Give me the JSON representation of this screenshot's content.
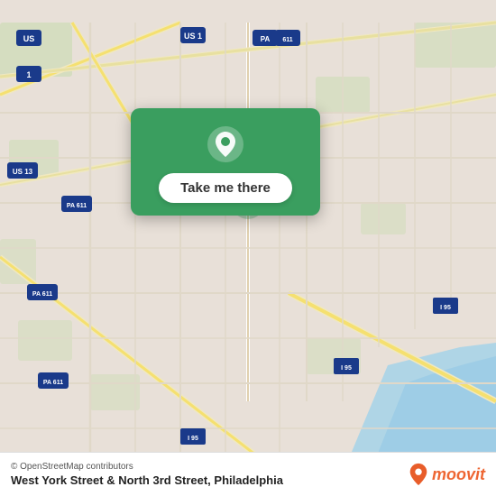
{
  "map": {
    "background_color": "#e8e0d8",
    "attribution": "© OpenStreetMap contributors"
  },
  "card": {
    "button_label": "Take me there",
    "icon_alt": "location-pin"
  },
  "bottom_bar": {
    "location_name": "West York Street & North 3rd Street, Philadelphia",
    "moovit_label": "moovit"
  }
}
